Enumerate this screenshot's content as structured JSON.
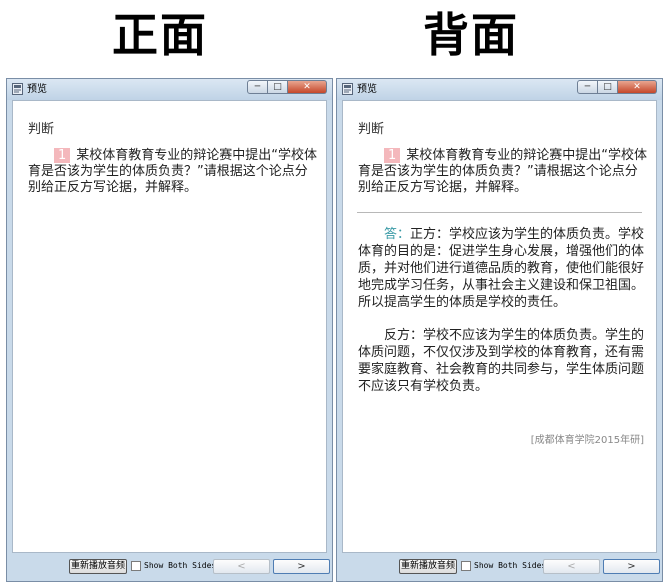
{
  "headings": {
    "front": "正面",
    "back": "背面"
  },
  "window": {
    "title": "预览",
    "minimize": "─",
    "maximize": "□",
    "close": "✕"
  },
  "card": {
    "type": "判断",
    "number": "1",
    "question": "某校体育教育专业的辩论赛中提出“学校体育是否该为学生的体质负责？”请根据这个论点分别给正反方写论据，并解释。",
    "answer_label": "答：",
    "answer_pro": "正方：学校应该为学生的体质负责。学校体育的目的是：促进学生身心发展，增强他们的体质，并对他们进行道德品质的教育，使他们能很好地完成学习任务，从事社会主义建设和保卫祖国。所以提高学生的体质是学校的责任。",
    "answer_con": "反方：学校不应该为学生的体质负责。学生的体质问题，不仅仅涉及到学校的体育教育，还有需要家庭教育、社会教育的共同参与，学生体质问题不应该只有学校负责。",
    "source": "[成都体育学院2015年研]"
  },
  "bottombar": {
    "replay_label": "重新播放音频",
    "show_both_label": "Show Both Sides",
    "prev_label": "<",
    "next_label": ">"
  },
  "colors": {
    "accent": "#3a9aa6",
    "badge": "#f4b8bc",
    "titlebar": "#c9daea"
  }
}
